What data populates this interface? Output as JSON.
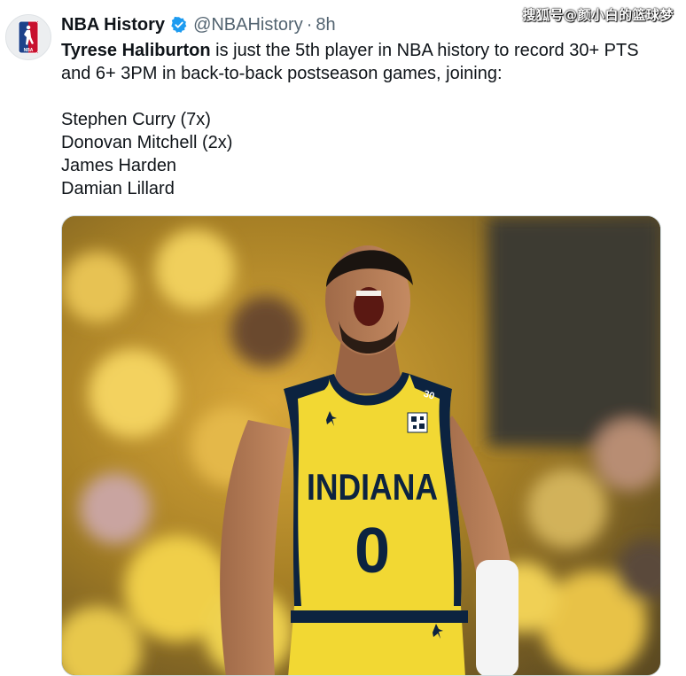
{
  "tweet": {
    "author_name": "NBA History",
    "author_handle": "@NBAHistory",
    "separator": "·",
    "timestamp": "8h",
    "verified": true,
    "text_bold": "Tyrese Haliburton",
    "text_rest": " is just the 5th player in NBA history to record 30+ PTS and 6+ 3PM in back-to-back postseason games, joining:",
    "players": [
      "Stephen Curry (7x)",
      "Donovan Mitchell (2x)",
      "James Harden",
      "Damian Lillard"
    ]
  },
  "watermark": "搜狐号@颜小白的篮球梦",
  "photo": {
    "jersey_team": "INDIANA",
    "jersey_number": "0",
    "strap_number": "30"
  },
  "icons": {
    "avatar": "nba-logo-icon",
    "verified": "verified-badge-icon"
  },
  "colors": {
    "verified_blue": "#1d9bf0",
    "jersey_yellow": "#f2d833",
    "jersey_navy": "#0c2340"
  }
}
